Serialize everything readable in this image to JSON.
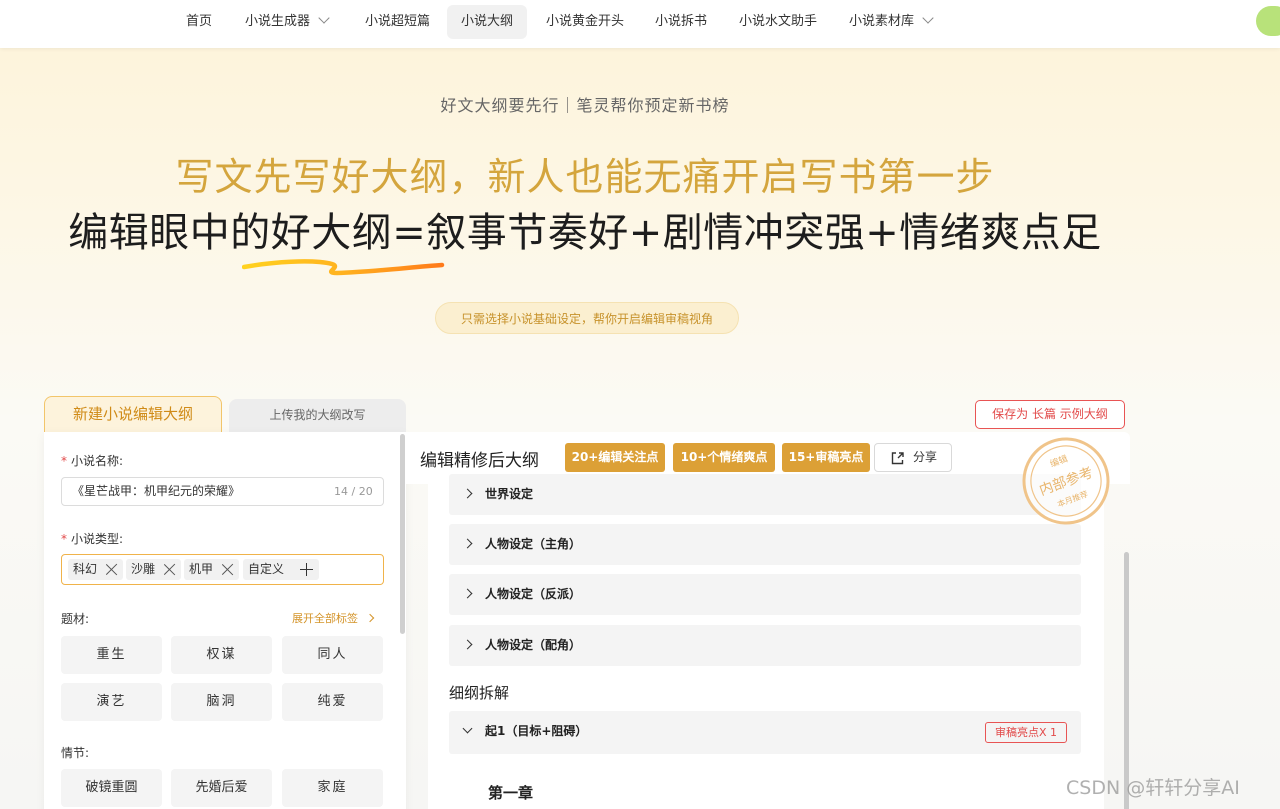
{
  "nav": {
    "items": [
      {
        "label": "首页",
        "active": false,
        "dropdown": false
      },
      {
        "label": "小说生成器",
        "active": false,
        "dropdown": true
      },
      {
        "label": "小说超短篇",
        "active": false,
        "dropdown": false
      },
      {
        "label": "小说大纲",
        "active": true,
        "dropdown": false
      },
      {
        "label": "小说黄金开头",
        "active": false,
        "dropdown": false
      },
      {
        "label": "小说拆书",
        "active": false,
        "dropdown": false
      },
      {
        "label": "小说水文助手",
        "active": false,
        "dropdown": false
      },
      {
        "label": "小说素材库",
        "active": false,
        "dropdown": true
      }
    ]
  },
  "hero": {
    "subtitle": "好文大纲要先行｜笔灵帮你预定新书榜",
    "line1": "写文先写好大纲，新人也能无痛开启写书第一步",
    "line2": "编辑眼中的好大纲=叙事节奏好+剧情冲突强+情绪爽点足",
    "tip": "只需选择小说基础设定，帮你开启编辑审稿视角"
  },
  "tabs": {
    "new_outline": "新建小说编辑大纲",
    "upload": "上传我的大纲改写"
  },
  "save_button": "保存为 长篇 示例大纲",
  "form": {
    "name_label": "小说名称:",
    "name_value": "《星芒战甲：机甲纪元的荣耀》",
    "name_count": "14 / 20",
    "type_label": "小说类型:",
    "type_tags": [
      "科幻",
      "沙雕",
      "机甲"
    ],
    "type_custom": "自定义",
    "theme_label": "题材:",
    "expand_all": "展开全部标签",
    "theme_chips": [
      "重生",
      "权谋",
      "同人",
      "演艺",
      "脑洞",
      "纯爱"
    ],
    "plot_label": "情节:",
    "plot_chips": [
      "破镜重圆",
      "先婚后爱",
      "家庭"
    ]
  },
  "outline": {
    "title": "编辑精修后大纲",
    "badges": [
      "20+编辑关注点",
      "10+个情绪爽点",
      "15+审稿亮点"
    ],
    "share": "分享",
    "settings": [
      "世界设定",
      "人物设定（主角）",
      "人物设定（反派）",
      "人物设定（配角）"
    ],
    "detail_title": "细纲拆解",
    "detail_item": "起1（目标+阻碍）",
    "detail_badge": "审稿亮点X 1",
    "chapter": "第一章"
  },
  "stamp": {
    "top": "编辑",
    "middle": "内部参考",
    "bottom": "本月推荐"
  },
  "watermark": "CSDN @轩轩分享AI",
  "colors": {
    "accent": "#dca036",
    "hero_gold": "#d4a53d",
    "danger": "#e24a4a",
    "stamp": "#f0c48a"
  }
}
